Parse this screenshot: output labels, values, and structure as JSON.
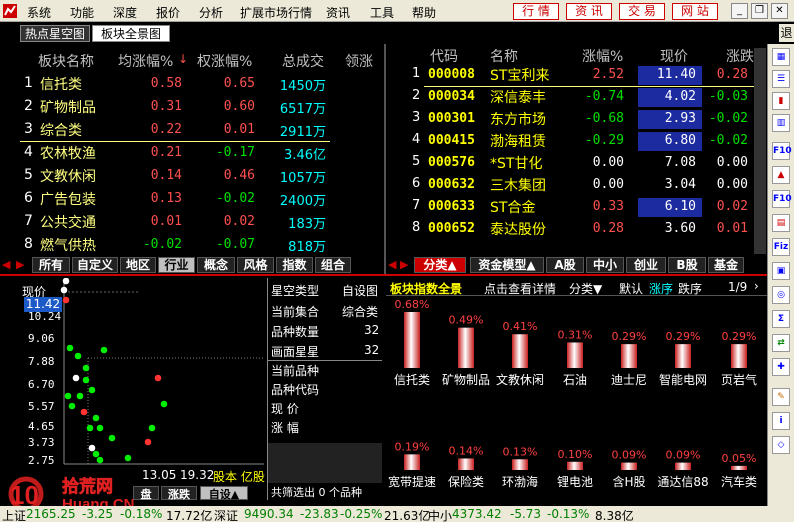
{
  "menu": {
    "items": [
      "系统",
      "功能",
      "深度",
      "报价",
      "分析",
      "扩展市场行情",
      "资讯",
      "工具",
      "帮助"
    ],
    "quick": [
      "行 情",
      "资 讯",
      "交 易",
      "网 站"
    ]
  },
  "tabs": {
    "left": "热点星空图",
    "right": "板块全景图",
    "exit": "退"
  },
  "left_table": {
    "headers": [
      "板块名称",
      "均涨幅%",
      "权涨幅%",
      "总成交",
      "领涨"
    ],
    "rows": [
      {
        "no": "1",
        "name": "信托类",
        "avg": "0.58",
        "wt": "0.65",
        "vol": "1450万"
      },
      {
        "no": "2",
        "name": "矿物制品",
        "avg": "0.31",
        "wt": "0.60",
        "vol": "6517万"
      },
      {
        "no": "3",
        "name": "综合类",
        "avg": "0.22",
        "wt": "0.01",
        "vol": "2911万"
      },
      {
        "no": "4",
        "name": "农林牧渔",
        "avg": "0.21",
        "wt": "-0.17",
        "vol": "3.46亿"
      },
      {
        "no": "5",
        "name": "文教休闲",
        "avg": "0.14",
        "wt": "0.46",
        "vol": "1057万"
      },
      {
        "no": "6",
        "name": "广告包装",
        "avg": "0.13",
        "wt": "-0.02",
        "vol": "2400万"
      },
      {
        "no": "7",
        "name": "公共交通",
        "avg": "0.01",
        "wt": "0.02",
        "vol": "183万"
      },
      {
        "no": "8",
        "name": "燃气供热",
        "avg": "-0.02",
        "wt": "-0.07",
        "vol": "818万"
      }
    ]
  },
  "left_strip": [
    "所有",
    "自定义",
    "地区",
    "行业",
    "概念",
    "风格",
    "指数",
    "组合"
  ],
  "right_table": {
    "headers": [
      "代码",
      "名称",
      "涨幅%",
      "现价",
      "涨跌"
    ],
    "rows": [
      {
        "no": "1",
        "code": "000008",
        "name": "ST宝利来",
        "pct": "2.52",
        "price": "11.40",
        "chg": "0.28"
      },
      {
        "no": "2",
        "code": "000034",
        "name": "深信泰丰",
        "pct": "-0.74",
        "price": "4.02",
        "chg": "-0.03"
      },
      {
        "no": "3",
        "code": "000301",
        "name": "东方市场",
        "pct": "-0.68",
        "price": "2.93",
        "chg": "-0.02"
      },
      {
        "no": "4",
        "code": "000415",
        "name": "渤海租赁",
        "pct": "-0.29",
        "price": "6.80",
        "chg": "-0.02"
      },
      {
        "no": "5",
        "code": "000576",
        "name": "*ST甘化",
        "pct": "0.00",
        "price": "7.08",
        "chg": "0.00"
      },
      {
        "no": "6",
        "code": "000632",
        "name": "三木集团",
        "pct": "0.00",
        "price": "3.04",
        "chg": "0.00"
      },
      {
        "no": "7",
        "code": "000633",
        "name": "ST合金",
        "pct": "0.33",
        "price": "6.10",
        "chg": "0.02"
      },
      {
        "no": "8",
        "code": "000652",
        "name": "泰达股份",
        "pct": "0.28",
        "price": "3.60",
        "chg": "0.01"
      }
    ]
  },
  "right_strip": [
    "分类▲",
    "资金模型▲",
    "A股",
    "中小",
    "创业",
    "B股",
    "基金"
  ],
  "scatter": {
    "ylabel": "现价",
    "current": "11.42",
    "yticks": [
      "10.24",
      "9.06",
      "7.88",
      "6.70",
      "5.57",
      "4.65",
      "3.73",
      "2.75"
    ],
    "xlabels": [
      "13.05",
      "19.32"
    ],
    "units": "股本 亿股",
    "strip": [
      "盘",
      "涨跌",
      "自设▲"
    ]
  },
  "info_panel": {
    "rows": [
      {
        "k": "星空类型",
        "v": "自设图"
      },
      {
        "k": "当前集合",
        "v": "综合类"
      },
      {
        "k": "品种数量",
        "v": "32"
      },
      {
        "k": "画面星星",
        "v": "32"
      }
    ],
    "fields": [
      "当前品种",
      "品种代码",
      "现 价",
      "涨 幅"
    ],
    "footer": "共筛选出 0 个品种"
  },
  "bar_panel": {
    "title": "板块指数全景",
    "link": "点击查看详情",
    "controls": [
      "分类▼",
      "默认",
      "涨序",
      "跌序"
    ],
    "page": "1/9"
  },
  "chart_data": {
    "type": "bar",
    "categories": [
      "信托类",
      "矿物制品",
      "文教休闲",
      "石油",
      "迪士尼",
      "智能电网",
      "页岩气",
      "宽带提速",
      "保险类",
      "环渤海",
      "锂电池",
      "含H股",
      "通达信88",
      "汽车类"
    ],
    "values": [
      0.68,
      0.49,
      0.41,
      0.31,
      0.29,
      0.29,
      0.29,
      0.19,
      0.14,
      0.13,
      0.1,
      0.09,
      0.09,
      0.05
    ],
    "labels": [
      "0.68%",
      "0.49%",
      "0.41%",
      "0.31%",
      "0.29%",
      "0.29%",
      "0.29%",
      "0.19%",
      "0.14%",
      "0.13%",
      "0.10%",
      "0.09%",
      "0.09%",
      "0.05%"
    ]
  },
  "status": {
    "items": [
      {
        "t": "上证",
        "c": "#000"
      },
      {
        "t": "2165.25",
        "c": "#008000"
      },
      {
        "t": "-3.25",
        "c": "#008000"
      },
      {
        "t": "-0.18%",
        "c": "#008000"
      },
      {
        "t": "17.72亿",
        "c": "#000"
      },
      {
        "t": "深证",
        "c": "#000"
      },
      {
        "t": "9490.34",
        "c": "#008000"
      },
      {
        "t": "-23.83",
        "c": "#008000"
      },
      {
        "t": "-0.25%",
        "c": "#008000"
      },
      {
        "t": "21.63亿",
        "c": "#000"
      },
      {
        "t": "中小",
        "c": "#000"
      },
      {
        "t": "4373.42",
        "c": "#008000"
      },
      {
        "t": "-5.73",
        "c": "#008000"
      },
      {
        "t": "-0.13%",
        "c": "#008000"
      },
      {
        "t": "8.38亿",
        "c": "#000"
      }
    ]
  },
  "watermark": "10 拾荒网 Huang.CN",
  "colors": {
    "up": "#ff5050",
    "down": "#00e000",
    "highlight": "#1c2ba0"
  }
}
